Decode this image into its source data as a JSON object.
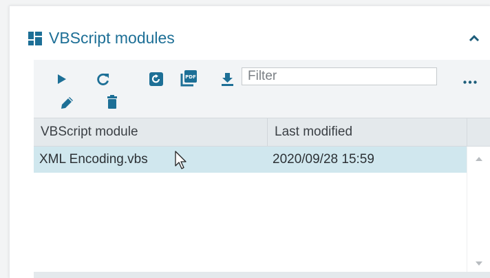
{
  "panel": {
    "title": "VBScript modules",
    "title_icon": "dashboard-icon",
    "collapse_icon": "chevron-up-icon"
  },
  "toolbar": {
    "buttons": [
      {
        "icon": "play-icon",
        "label": "Run"
      },
      {
        "icon": "refresh-icon",
        "label": "Refresh"
      },
      {
        "icon": "restore-icon",
        "label": "Restore"
      },
      {
        "icon": "pdf-icon",
        "label": "Export PDF"
      },
      {
        "icon": "download-icon",
        "label": "Download"
      },
      {
        "icon": "edit-icon",
        "label": "Edit"
      },
      {
        "icon": "delete-icon",
        "label": "Delete"
      },
      {
        "icon": "more-icon",
        "label": "More"
      }
    ],
    "filter_placeholder": "Filter",
    "filter_value": ""
  },
  "grid": {
    "columns": [
      "VBScript module",
      "Last modified"
    ],
    "rows": [
      {
        "module": "XML Encoding.vbs",
        "modified": "2020/09/28 15:59",
        "selected": true
      }
    ]
  },
  "colors": {
    "accent": "#1d6f96",
    "selected_row": "#d0e7ee",
    "header_bg": "#e4e9ec"
  }
}
